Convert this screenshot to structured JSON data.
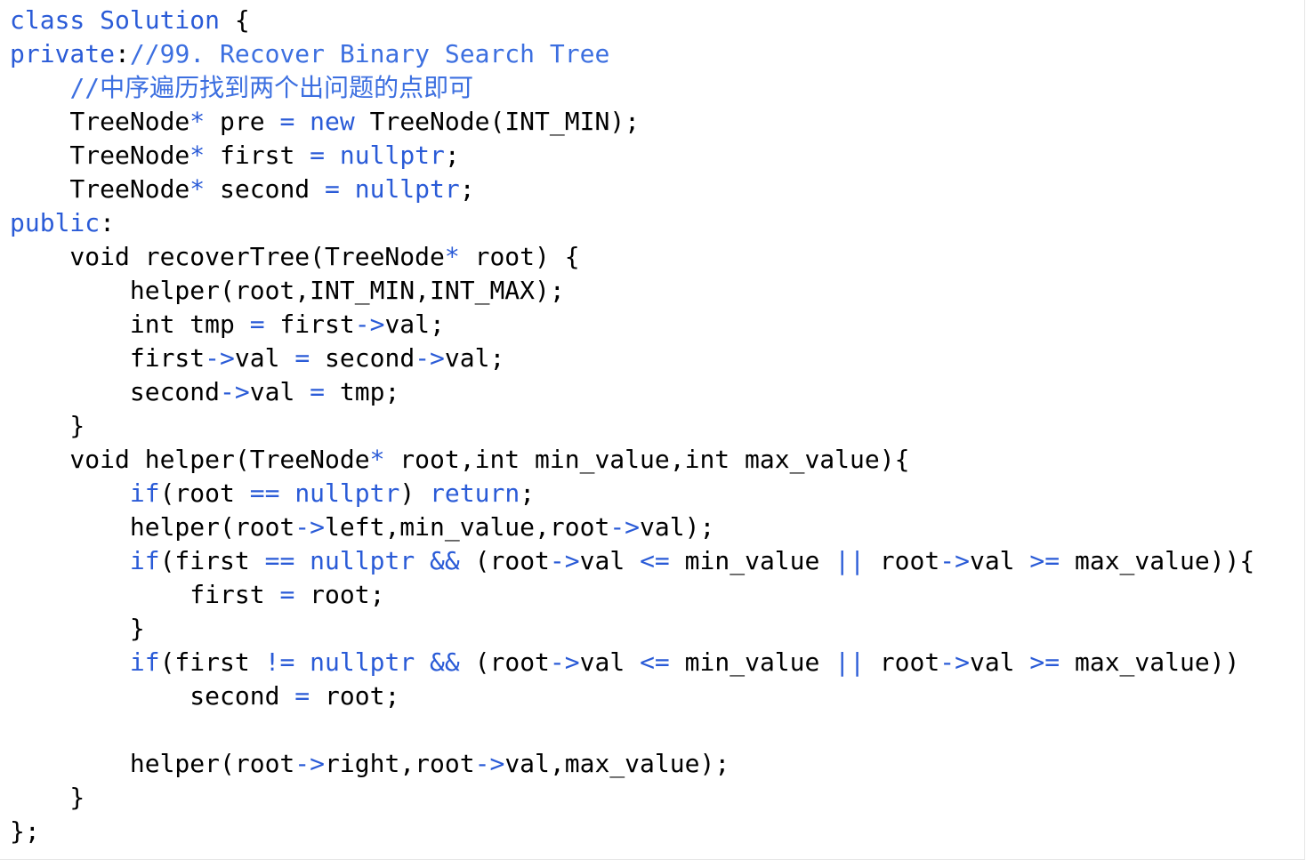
{
  "editor": {
    "lines": [
      [
        {
          "t": "class Solution",
          "c": "kw"
        },
        {
          "t": " {",
          "c": "tx"
        }
      ],
      [
        {
          "t": "private",
          "c": "kw"
        },
        {
          "t": ":",
          "c": "tx"
        },
        {
          "t": "//99. Recover Binary Search Tree",
          "c": "cm"
        }
      ],
      [
        {
          "t": "    ",
          "c": "tx"
        },
        {
          "t": "//中序遍历找到两个出问题的点即可",
          "c": "cm"
        }
      ],
      [
        {
          "t": "    TreeNode",
          "c": "tx"
        },
        {
          "t": "*",
          "c": "op"
        },
        {
          "t": " pre ",
          "c": "tx"
        },
        {
          "t": "=",
          "c": "op"
        },
        {
          "t": " ",
          "c": "tx"
        },
        {
          "t": "new",
          "c": "kw"
        },
        {
          "t": " TreeNode(INT_MIN);",
          "c": "tx"
        }
      ],
      [
        {
          "t": "    TreeNode",
          "c": "tx"
        },
        {
          "t": "*",
          "c": "op"
        },
        {
          "t": " first ",
          "c": "tx"
        },
        {
          "t": "=",
          "c": "op"
        },
        {
          "t": " ",
          "c": "tx"
        },
        {
          "t": "nullptr",
          "c": "kw"
        },
        {
          "t": ";",
          "c": "tx"
        }
      ],
      [
        {
          "t": "    TreeNode",
          "c": "tx"
        },
        {
          "t": "*",
          "c": "op"
        },
        {
          "t": " second ",
          "c": "tx"
        },
        {
          "t": "=",
          "c": "op"
        },
        {
          "t": " ",
          "c": "tx"
        },
        {
          "t": "nullptr",
          "c": "kw"
        },
        {
          "t": ";",
          "c": "tx"
        }
      ],
      [
        {
          "t": "public",
          "c": "kw"
        },
        {
          "t": ":",
          "c": "tx"
        }
      ],
      [
        {
          "t": "    void recoverTree(TreeNode",
          "c": "tx"
        },
        {
          "t": "*",
          "c": "op"
        },
        {
          "t": " root) {",
          "c": "tx"
        }
      ],
      [
        {
          "t": "        helper(root,INT_MIN,INT_MAX);",
          "c": "tx"
        }
      ],
      [
        {
          "t": "        int tmp ",
          "c": "tx"
        },
        {
          "t": "=",
          "c": "op"
        },
        {
          "t": " first",
          "c": "tx"
        },
        {
          "t": "->",
          "c": "op"
        },
        {
          "t": "val;",
          "c": "tx"
        }
      ],
      [
        {
          "t": "        first",
          "c": "tx"
        },
        {
          "t": "->",
          "c": "op"
        },
        {
          "t": "val ",
          "c": "tx"
        },
        {
          "t": "=",
          "c": "op"
        },
        {
          "t": " second",
          "c": "tx"
        },
        {
          "t": "->",
          "c": "op"
        },
        {
          "t": "val;",
          "c": "tx"
        }
      ],
      [
        {
          "t": "        second",
          "c": "tx"
        },
        {
          "t": "->",
          "c": "op"
        },
        {
          "t": "val ",
          "c": "tx"
        },
        {
          "t": "=",
          "c": "op"
        },
        {
          "t": " tmp;",
          "c": "tx"
        }
      ],
      [
        {
          "t": "    }",
          "c": "tx"
        }
      ],
      [
        {
          "t": "    void helper(TreeNode",
          "c": "tx"
        },
        {
          "t": "*",
          "c": "op"
        },
        {
          "t": " root,int min_value,int max_value){",
          "c": "tx"
        }
      ],
      [
        {
          "t": "        ",
          "c": "tx"
        },
        {
          "t": "if",
          "c": "kw"
        },
        {
          "t": "(root ",
          "c": "tx"
        },
        {
          "t": "==",
          "c": "op"
        },
        {
          "t": " ",
          "c": "tx"
        },
        {
          "t": "nullptr",
          "c": "kw"
        },
        {
          "t": ") ",
          "c": "tx"
        },
        {
          "t": "return",
          "c": "kw"
        },
        {
          "t": ";",
          "c": "tx"
        }
      ],
      [
        {
          "t": "        helper(root",
          "c": "tx"
        },
        {
          "t": "->",
          "c": "op"
        },
        {
          "t": "left,min_value,root",
          "c": "tx"
        },
        {
          "t": "->",
          "c": "op"
        },
        {
          "t": "val);",
          "c": "tx"
        }
      ],
      [
        {
          "t": "        ",
          "c": "tx"
        },
        {
          "t": "if",
          "c": "kw"
        },
        {
          "t": "(first ",
          "c": "tx"
        },
        {
          "t": "==",
          "c": "op"
        },
        {
          "t": " ",
          "c": "tx"
        },
        {
          "t": "nullptr",
          "c": "kw"
        },
        {
          "t": " ",
          "c": "tx"
        },
        {
          "t": "&&",
          "c": "op"
        },
        {
          "t": " (root",
          "c": "tx"
        },
        {
          "t": "->",
          "c": "op"
        },
        {
          "t": "val ",
          "c": "tx"
        },
        {
          "t": "<=",
          "c": "op"
        },
        {
          "t": " min_value ",
          "c": "tx"
        },
        {
          "t": "||",
          "c": "op"
        },
        {
          "t": " root",
          "c": "tx"
        },
        {
          "t": "->",
          "c": "op"
        },
        {
          "t": "val ",
          "c": "tx"
        },
        {
          "t": ">=",
          "c": "op"
        },
        {
          "t": " max_value)){",
          "c": "tx"
        }
      ],
      [
        {
          "t": "            first ",
          "c": "tx"
        },
        {
          "t": "=",
          "c": "op"
        },
        {
          "t": " root;",
          "c": "tx"
        }
      ],
      [
        {
          "t": "        }",
          "c": "tx"
        }
      ],
      [
        {
          "t": "        ",
          "c": "tx"
        },
        {
          "t": "if",
          "c": "kw"
        },
        {
          "t": "(first ",
          "c": "tx"
        },
        {
          "t": "!=",
          "c": "op"
        },
        {
          "t": " ",
          "c": "tx"
        },
        {
          "t": "nullptr",
          "c": "kw"
        },
        {
          "t": " ",
          "c": "tx"
        },
        {
          "t": "&&",
          "c": "op"
        },
        {
          "t": " (root",
          "c": "tx"
        },
        {
          "t": "->",
          "c": "op"
        },
        {
          "t": "val ",
          "c": "tx"
        },
        {
          "t": "<=",
          "c": "op"
        },
        {
          "t": " min_value ",
          "c": "tx"
        },
        {
          "t": "||",
          "c": "op"
        },
        {
          "t": " root",
          "c": "tx"
        },
        {
          "t": "->",
          "c": "op"
        },
        {
          "t": "val ",
          "c": "tx"
        },
        {
          "t": ">=",
          "c": "op"
        },
        {
          "t": " max_value))",
          "c": "tx"
        }
      ],
      [
        {
          "t": "            second ",
          "c": "tx"
        },
        {
          "t": "=",
          "c": "op"
        },
        {
          "t": " root;",
          "c": "tx"
        }
      ],
      [],
      [
        {
          "t": "        helper(root",
          "c": "tx"
        },
        {
          "t": "->",
          "c": "op"
        },
        {
          "t": "right,root",
          "c": "tx"
        },
        {
          "t": "->",
          "c": "op"
        },
        {
          "t": "val,max_value);",
          "c": "tx"
        }
      ],
      [
        {
          "t": "    }",
          "c": "tx"
        }
      ],
      [
        {
          "t": "};",
          "c": "tx"
        }
      ]
    ]
  },
  "colors": {
    "keyword": "#2a5bd7",
    "comment": "#3c6fe0",
    "text": "#000000",
    "background": "#ffffff"
  }
}
